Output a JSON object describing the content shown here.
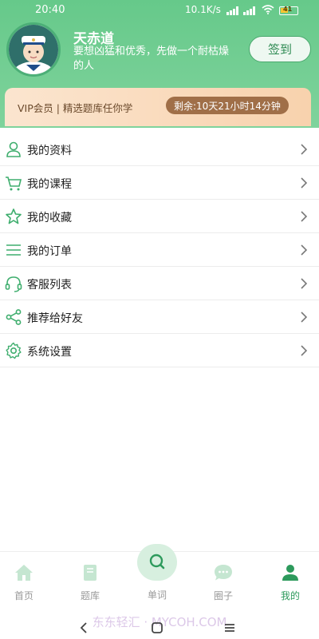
{
  "status_bar": {
    "time": "20:40",
    "network": "10.1K/s",
    "battery": "41"
  },
  "profile": {
    "name": "天赤道",
    "motto": "要想凶猛和优秀，先做一个耐枯燥的人",
    "signin_label": "签到"
  },
  "vip_banner": {
    "text": "VIP会员 | 精选题库任你学",
    "remaining": "剩余:10天21小时14分钟"
  },
  "menu": [
    {
      "label": "我的资料",
      "icon": "user-icon"
    },
    {
      "label": "我的课程",
      "icon": "cart-icon"
    },
    {
      "label": "我的收藏",
      "icon": "star-icon"
    },
    {
      "label": "我的订单",
      "icon": "list-icon"
    },
    {
      "label": "客服列表",
      "icon": "headset-icon"
    },
    {
      "label": "推荐给好友",
      "icon": "share-icon"
    },
    {
      "label": "系统设置",
      "icon": "gear-icon"
    }
  ],
  "bottom_nav": {
    "home": "首页",
    "questions": "题库",
    "words": "单词",
    "circle": "圈子",
    "mine": "我的",
    "active": "mine"
  },
  "watermark": "东东轻汇 · MYCOH.COM",
  "colors": {
    "primary_green": "#66c98a",
    "accent_green": "#2d9a5c",
    "vip_banner": "#f8d2ad",
    "timer_bg": "#a06f48"
  }
}
